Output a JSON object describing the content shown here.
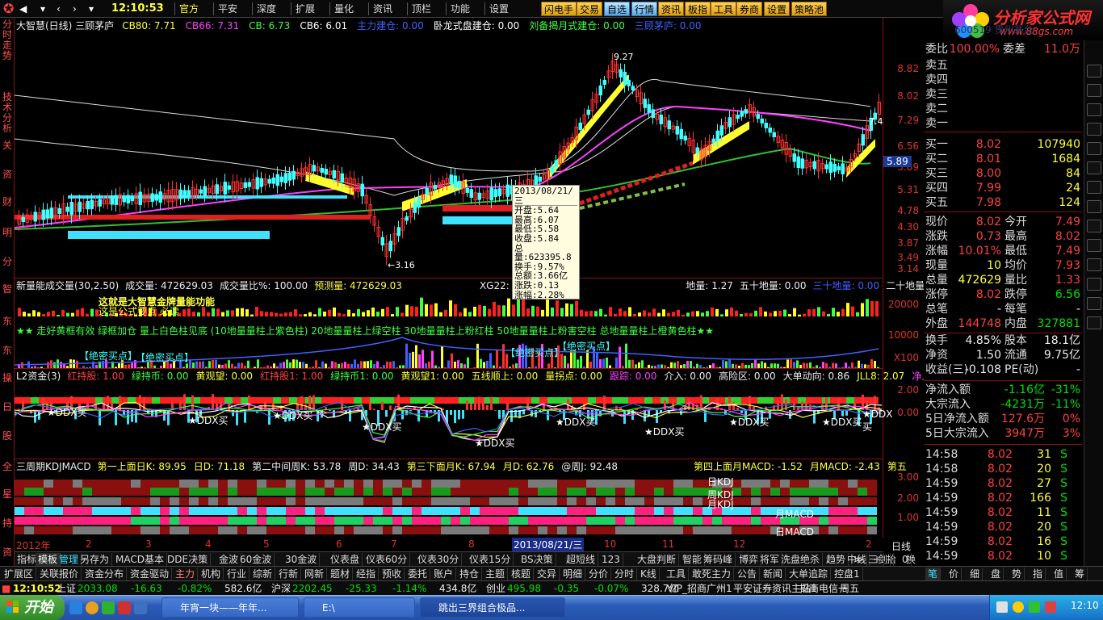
{
  "topbar": {
    "time": "12:10:53",
    "menus": [
      "官方",
      "平安",
      "深度",
      "扩展",
      "量化",
      "资讯",
      "顶栏",
      "功能",
      "设置"
    ],
    "hot_buttons": [
      "闪电手",
      "交易",
      "自选",
      "行情",
      "资讯",
      "板指",
      "工具",
      "券商",
      "设置",
      "策略池"
    ]
  },
  "logo": {
    "text": "分析家公式网",
    "url": "www.88gs.com"
  },
  "left_nav": [
    "分时走势",
    "技术分析",
    "关",
    "资",
    "财",
    "明",
    "分",
    "智",
    "东",
    "东",
    "操",
    "日",
    "股",
    "全",
    "星",
    "持",
    "资"
  ],
  "main_chart": {
    "title": "大智慧(日线) 三顾茅庐",
    "indicators": [
      {
        "label": "CB80: 7.71",
        "color": "#ffff40"
      },
      {
        "label": "CB66: 7.31",
        "color": "#ff40ff"
      },
      {
        "label": "CB: 6.73",
        "color": "#40ff40"
      },
      {
        "label": "CB6: 6.01",
        "color": "#ffffff"
      },
      {
        "label": "主力建仓: 0.00",
        "color": "#4060ff"
      },
      {
        "label": "卧龙式盘建仓: 0.00",
        "color": "#ffffff"
      },
      {
        "label": "刘备揭月式建仓: 0.00",
        "color": "#40ff40"
      },
      {
        "label": "三顾茅庐: 0.00",
        "color": "#4060ff"
      }
    ],
    "price_high_label": "9.27",
    "price_low_label": "3.16",
    "right_label": "7.4",
    "yaxis": [
      "8.82",
      "8.02",
      "7.29",
      "6.56",
      "5.89",
      "5.31",
      "4.78",
      "4.30",
      "3.87",
      "3.49",
      "3.14"
    ],
    "current_price_tag": "5.89"
  },
  "info_box": {
    "date": "2013/08/21/三",
    "rows": [
      "开盘:5.64",
      "最高:6.07",
      "最低:5.58",
      "收盘:5.84",
      "总量:623395.8",
      "换手:9.57%",
      "总额:3.66亿",
      "涨跌:0.13",
      "涨幅:2.28%"
    ]
  },
  "vol_panel": {
    "title": "新量能成交量(30,2.50)",
    "items": [
      "成交量: 472629.03",
      "成交量比%: 100.00",
      "预测量: 472629.03",
      "XG22: 0.00",
      "量能饱和",
      "地量: 1.27",
      "五十地量: 0.00",
      "三十地量: 0.00",
      "二十地量: 0.00"
    ],
    "legend": "★★ 走好黄框有效 绿框加仓 量上白色柱见底 (10地量量柱上紫色柱) 20地量量柱上绿空柱 30地量量柱上粉红柱 50地量量柱上粉害空柱 总地量量柱上橙黄色柱★★",
    "notes": [
      "这就是大智慧金牌量能功能",
      "这是公式要点 必读"
    ],
    "yaxis": [
      "20000",
      "10000",
      "X100"
    ],
    "buy_points": [
      "【绝密买点】",
      "【绝密买点】",
      "【绝密买点】",
      "【绝密买点】"
    ]
  },
  "l2_panel": {
    "title": "L2资金(3)",
    "items": [
      "红持股: 1.00",
      "绿持币: 0.00",
      "黄观望: 0.00",
      "红持股1: 1.00",
      "绿持币1: 0.00",
      "黄观望1: 0.00",
      "五线顺上: 0.00",
      "量拐点: 0.00",
      "跟踪: 0.00",
      "介入: 0.00",
      "高险区: 0.00",
      "大单动向: 0.86",
      "JLL8: 2.07",
      "净入"
    ],
    "ddx_labels": [
      "★DDX买",
      "★DDX买",
      "★DDX买",
      "★DDX买",
      "★DDX买",
      "★DDX买",
      "★DDX买",
      "★DDX买",
      "★DDX买",
      "★DDX买"
    ],
    "yaxis": [
      "2.00",
      "0.00"
    ]
  },
  "kdj_panel": {
    "title": "三周期KDJMACD",
    "items": [
      "第一上面日K: 89.95",
      "日D: 71.18",
      "第二中间周K: 53.78",
      "周D: 34.43",
      "第三下面月K: 67.94",
      "月D: 62.76",
      "@周J: 92.48",
      "第四上面月MACD: -1.52",
      "月MACD: -2.43",
      "第五"
    ],
    "row_labels": [
      "日KDJ",
      "周KDJ",
      "月KDJ",
      "月MACD",
      "日MACD"
    ],
    "yaxis": [
      "3.00",
      "2.00",
      "1.00"
    ]
  },
  "xaxis": {
    "labels": [
      "2012年",
      "2",
      "3",
      "4",
      "5",
      "6",
      "7",
      "8",
      "10",
      "11",
      "12",
      "2"
    ],
    "cursor": "2013/08/21/三"
  },
  "bottom_tabs1": [
    "指标",
    "模板",
    "管理",
    "另存为",
    "MACD基本",
    "DDE决策",
    "金波",
    "60金波",
    "30金波",
    "仪表盘",
    "仪表60分",
    "仪表30分",
    "仪表15分",
    "BS决策",
    "超短线",
    "123",
    "大盘判断",
    "智能",
    "筹码峰",
    "博弈",
    "将军",
    "洗盘绝杀",
    "趋势",
    "中线",
    "三剑",
    "≫",
    "+",
    "-",
    "0"
  ],
  "bottom_tabs2": [
    "扩展区",
    "关联报价",
    "资金分布",
    "资金驱动",
    "主力",
    "机构",
    "行业",
    "综新",
    "行新",
    "网新",
    "题材",
    "经指",
    "预收",
    "委托",
    "账户",
    "持仓",
    "主题",
    "核题",
    "交异",
    "明细",
    "分价",
    "分时",
    "K线",
    "工具",
    "敢死主力",
    "公告",
    "新闻",
    "大单追踪",
    "控盘1"
  ],
  "quote": {
    "stock_code": "600519 贵州茅台",
    "weibi": {
      "label1": "委比",
      "v1": "100.00%",
      "label2": "委差",
      "v2": "11.0万"
    },
    "sells": [
      {
        "label": "卖五"
      },
      {
        "label": "卖四"
      },
      {
        "label": "卖三"
      },
      {
        "label": "卖二"
      },
      {
        "label": "卖一"
      }
    ],
    "buys": [
      {
        "label": "买一",
        "price": "8.02",
        "vol": "107940"
      },
      {
        "label": "买二",
        "price": "8.01",
        "vol": "1684"
      },
      {
        "label": "买三",
        "price": "8.00",
        "vol": "84"
      },
      {
        "label": "买四",
        "price": "7.99",
        "vol": "24"
      },
      {
        "label": "买五",
        "price": "7.98",
        "vol": "124"
      }
    ],
    "stats": [
      [
        "现价",
        "8.02",
        "今开",
        "7.49"
      ],
      [
        "涨跌",
        "0.73",
        "最高",
        "8.02"
      ],
      [
        "涨幅",
        "10.01%",
        "最低",
        "7.49"
      ],
      [
        "现量",
        "10",
        "均价",
        "7.93"
      ],
      [
        "总量",
        "472629",
        "量比",
        "1.33"
      ],
      [
        "涨停",
        "8.02",
        "跌停",
        "6.56"
      ],
      [
        "总笔",
        "-",
        "每笔",
        "-"
      ],
      [
        "外盘",
        "144748",
        "内盘",
        "327881"
      ],
      [
        "换手",
        "4.85%",
        "股本",
        "18.1亿"
      ],
      [
        "净资",
        "1.50",
        "流通",
        "9.75亿"
      ],
      [
        "收益(三)",
        "-0.108",
        "PE(动)",
        "-"
      ]
    ],
    "flows": [
      [
        "净流入额",
        "-1.16亿",
        "-31%"
      ],
      [
        "大宗流入",
        "-4231万",
        "-11%"
      ],
      [
        "5日净流入额",
        "127.6万",
        "0%"
      ],
      [
        "5日大宗流入",
        "3947万",
        "3%"
      ]
    ],
    "ticks": [
      [
        "14:58",
        "8.02",
        "31",
        "S"
      ],
      [
        "14:58",
        "8.02",
        "20",
        "S"
      ],
      [
        "14:59",
        "8.02",
        "27",
        "S"
      ],
      [
        "14:59",
        "8.02",
        "166",
        "S"
      ],
      [
        "14:59",
        "8.02",
        "11",
        "S"
      ],
      [
        "14:59",
        "8.02",
        "20",
        "S"
      ],
      [
        "14:59",
        "8.02",
        "16",
        "S"
      ],
      [
        "14:59",
        "8.02",
        "10",
        "S"
      ]
    ],
    "period": "日线",
    "tabs_a": [
      "拾",
      "换"
    ],
    "tabs_b": [
      "笔",
      "价",
      "细",
      "盘",
      "势",
      "指",
      "值",
      "筹"
    ]
  },
  "statusbar": {
    "time": "12:10:52",
    "items": [
      {
        "t": "上证",
        "c": "#eee"
      },
      {
        "t": "2033.08",
        "c": "#00e000"
      },
      {
        "t": "-16.63",
        "c": "#00e000"
      },
      {
        "t": "-0.82%",
        "c": "#00e000"
      },
      {
        "t": "582.6亿",
        "c": "#eee"
      },
      {
        "t": "沪深",
        "c": "#eee"
      },
      {
        "t": "2202.45",
        "c": "#00e000"
      },
      {
        "t": "-25.33",
        "c": "#00e000"
      },
      {
        "t": "-1.14%",
        "c": "#00e000"
      },
      {
        "t": "434.8亿",
        "c": "#eee"
      },
      {
        "t": "创业",
        "c": "#eee"
      },
      {
        "t": "495.98",
        "c": "#00e000"
      },
      {
        "t": "-0.35",
        "c": "#00e000"
      },
      {
        "t": "-0.07%",
        "c": "#00e000"
      },
      {
        "t": "328.7亿",
        "c": "#eee"
      },
      {
        "t": "VIP_招商广州1",
        "c": "#eee"
      },
      {
        "t": "平安证券资讯主站1",
        "c": "#eee"
      },
      {
        "t": "招商电信一",
        "c": "#eee"
      },
      {
        "t": "周五",
        "c": "#eee"
      }
    ]
  },
  "taskbar": {
    "start": "开始",
    "tasks": [
      "年宵一块——年年...",
      "E:\\",
      "跳出三界组合极品..."
    ],
    "clock": "12:10"
  }
}
